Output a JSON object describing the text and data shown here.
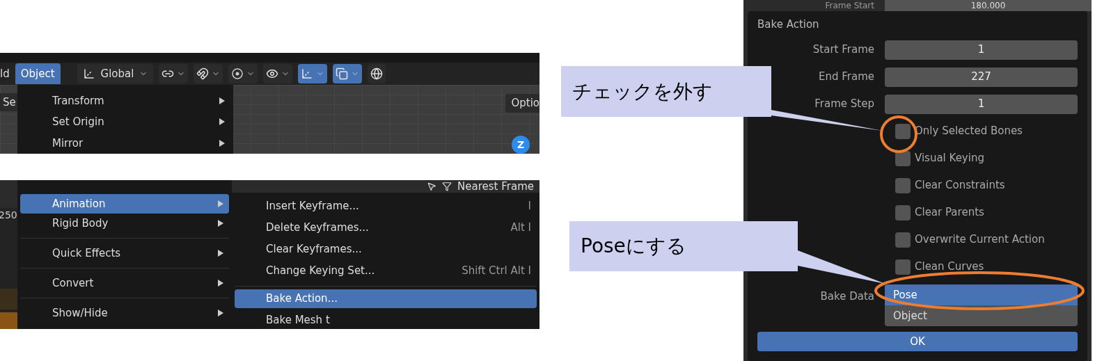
{
  "viewport_panel": {
    "partial_tab": "ld",
    "menu_button": {
      "label": "Object",
      "selected": true
    },
    "toolbar": [
      {
        "kind": "dropdown",
        "label": "Global"
      },
      {
        "kind": "toggle",
        "on": false
      },
      {
        "kind": "toggle",
        "on": false
      },
      {
        "kind": "toggle",
        "on": false
      },
      {
        "kind": "toggle",
        "on": false
      },
      {
        "kind": "toggle",
        "on": true
      },
      {
        "kind": "toggle",
        "on": true
      }
    ],
    "left_button": "Se",
    "options_button": "Optio",
    "axis_label": "Z",
    "menu_items": [
      {
        "label": "Transform"
      },
      {
        "label": "Set Origin"
      },
      {
        "label": "Mirror"
      }
    ]
  },
  "timeline_panel": {
    "frame_number": "250",
    "snap_mode": "Nearest Frame",
    "menu_items": [
      {
        "label": "Animation",
        "selected": true
      },
      {
        "label": "Rigid Body",
        "selected": false
      },
      {
        "label": "Quick Effects",
        "selected": false
      },
      {
        "label": "Convert",
        "selected": false
      },
      {
        "label": "Show/Hide",
        "selected": false
      }
    ],
    "submenu_items": [
      {
        "label": "Insert Keyframe...",
        "shortcut": "I",
        "selected": false
      },
      {
        "label": "Delete Keyframes...",
        "shortcut": "Alt I",
        "selected": false
      },
      {
        "label": "Clear Keyframes...",
        "selected": false
      },
      {
        "label": "Change Keying Set...",
        "shortcut": "Shift Ctrl Alt I",
        "selected": false
      },
      {
        "label": "Bake Action...",
        "selected": true
      },
      {
        "label": "Bake Mesh t",
        "selected": false
      }
    ]
  },
  "dialog": {
    "above_label": "Frame Start",
    "above_value": "180.000",
    "title": "Bake Action",
    "fields": [
      {
        "label": "Start Frame",
        "value": "1"
      },
      {
        "label": "End Frame",
        "value": "227"
      },
      {
        "label": "Frame Step",
        "value": "1"
      }
    ],
    "checkboxes": [
      {
        "label": "Only Selected Bones",
        "checked": false
      },
      {
        "label": "Visual Keying",
        "checked": false
      },
      {
        "label": "Clear Constraints",
        "checked": false
      },
      {
        "label": "Clear Parents",
        "checked": false
      },
      {
        "label": "Overwrite Current Action",
        "checked": false
      },
      {
        "label": "Clean Curves",
        "checked": false
      }
    ],
    "bake_data_label": "Bake Data",
    "bake_data_options": [
      {
        "label": "Pose",
        "selected": true
      },
      {
        "label": "Object",
        "selected": false
      }
    ],
    "ok_button": "OK"
  },
  "callouts": [
    {
      "text": "チェックを外す"
    },
    {
      "text": "Poseにする"
    }
  ]
}
